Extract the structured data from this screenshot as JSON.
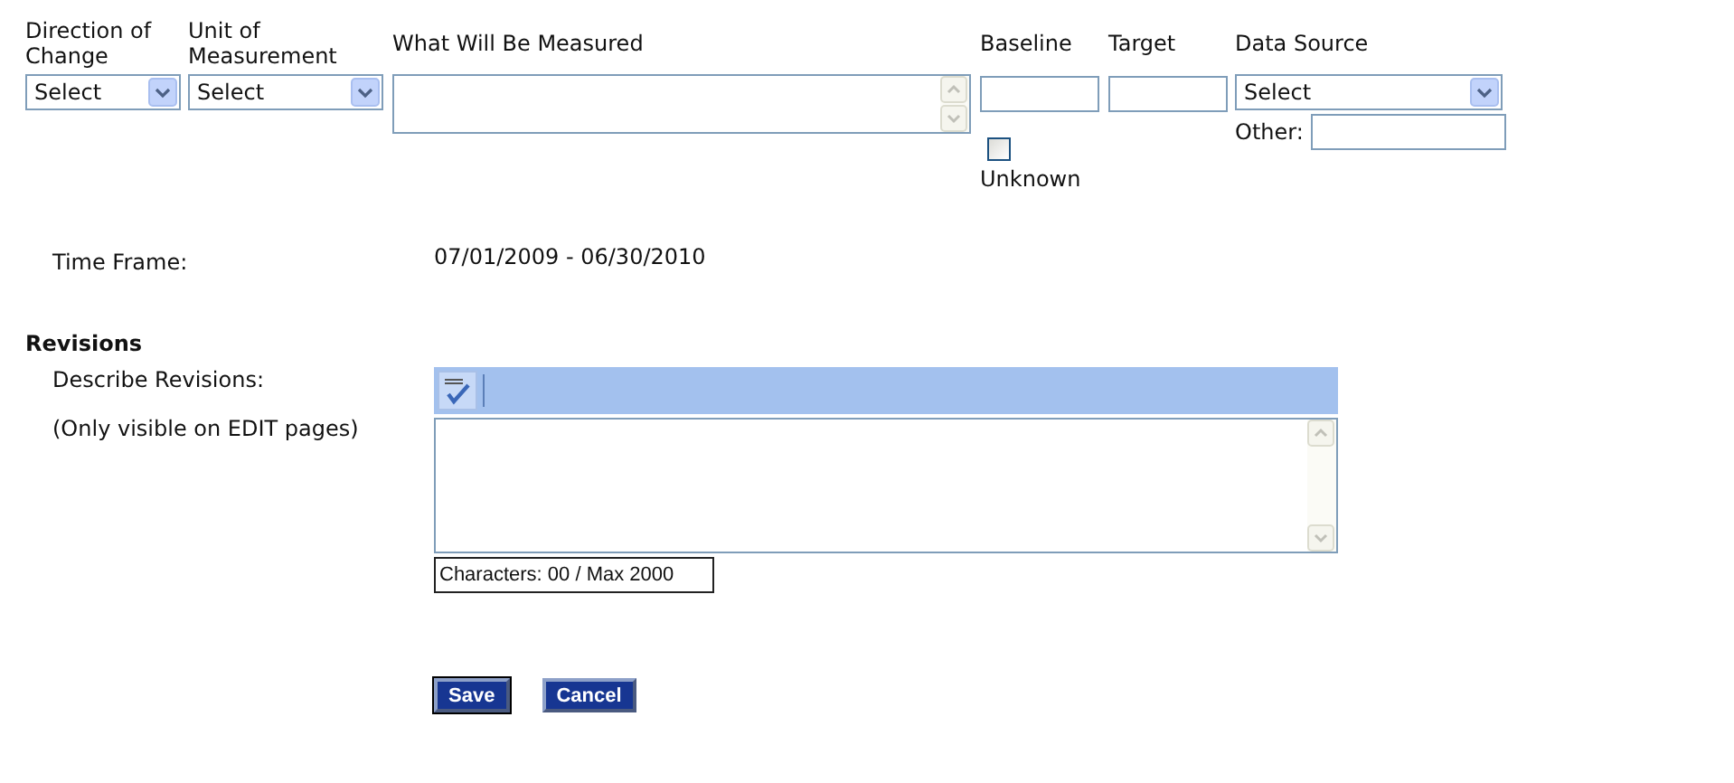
{
  "measure_headers": [
    "Direction of Change",
    "Unit of Measurement",
    "What Will Be Measured",
    "Baseline",
    "Target",
    "Data Source"
  ],
  "direction_select": {
    "value": "Select"
  },
  "unit_select": {
    "value": "Select"
  },
  "data_source_select": {
    "value": "Select"
  },
  "other_label": "Other:",
  "unknown": {
    "label": "Unknown",
    "checked": false
  },
  "time_frame": {
    "label": "Time Frame:",
    "value": "07/01/2009 - 06/30/2010"
  },
  "revisions": {
    "heading": "Revisions",
    "label": "Describe Revisions:",
    "note": "(Only visible on EDIT pages)",
    "counter": "Characters: 00 / Max 2000"
  },
  "buttons": [
    {
      "label": "Save",
      "focused": true
    },
    {
      "label": "Cancel",
      "focused": false
    }
  ]
}
